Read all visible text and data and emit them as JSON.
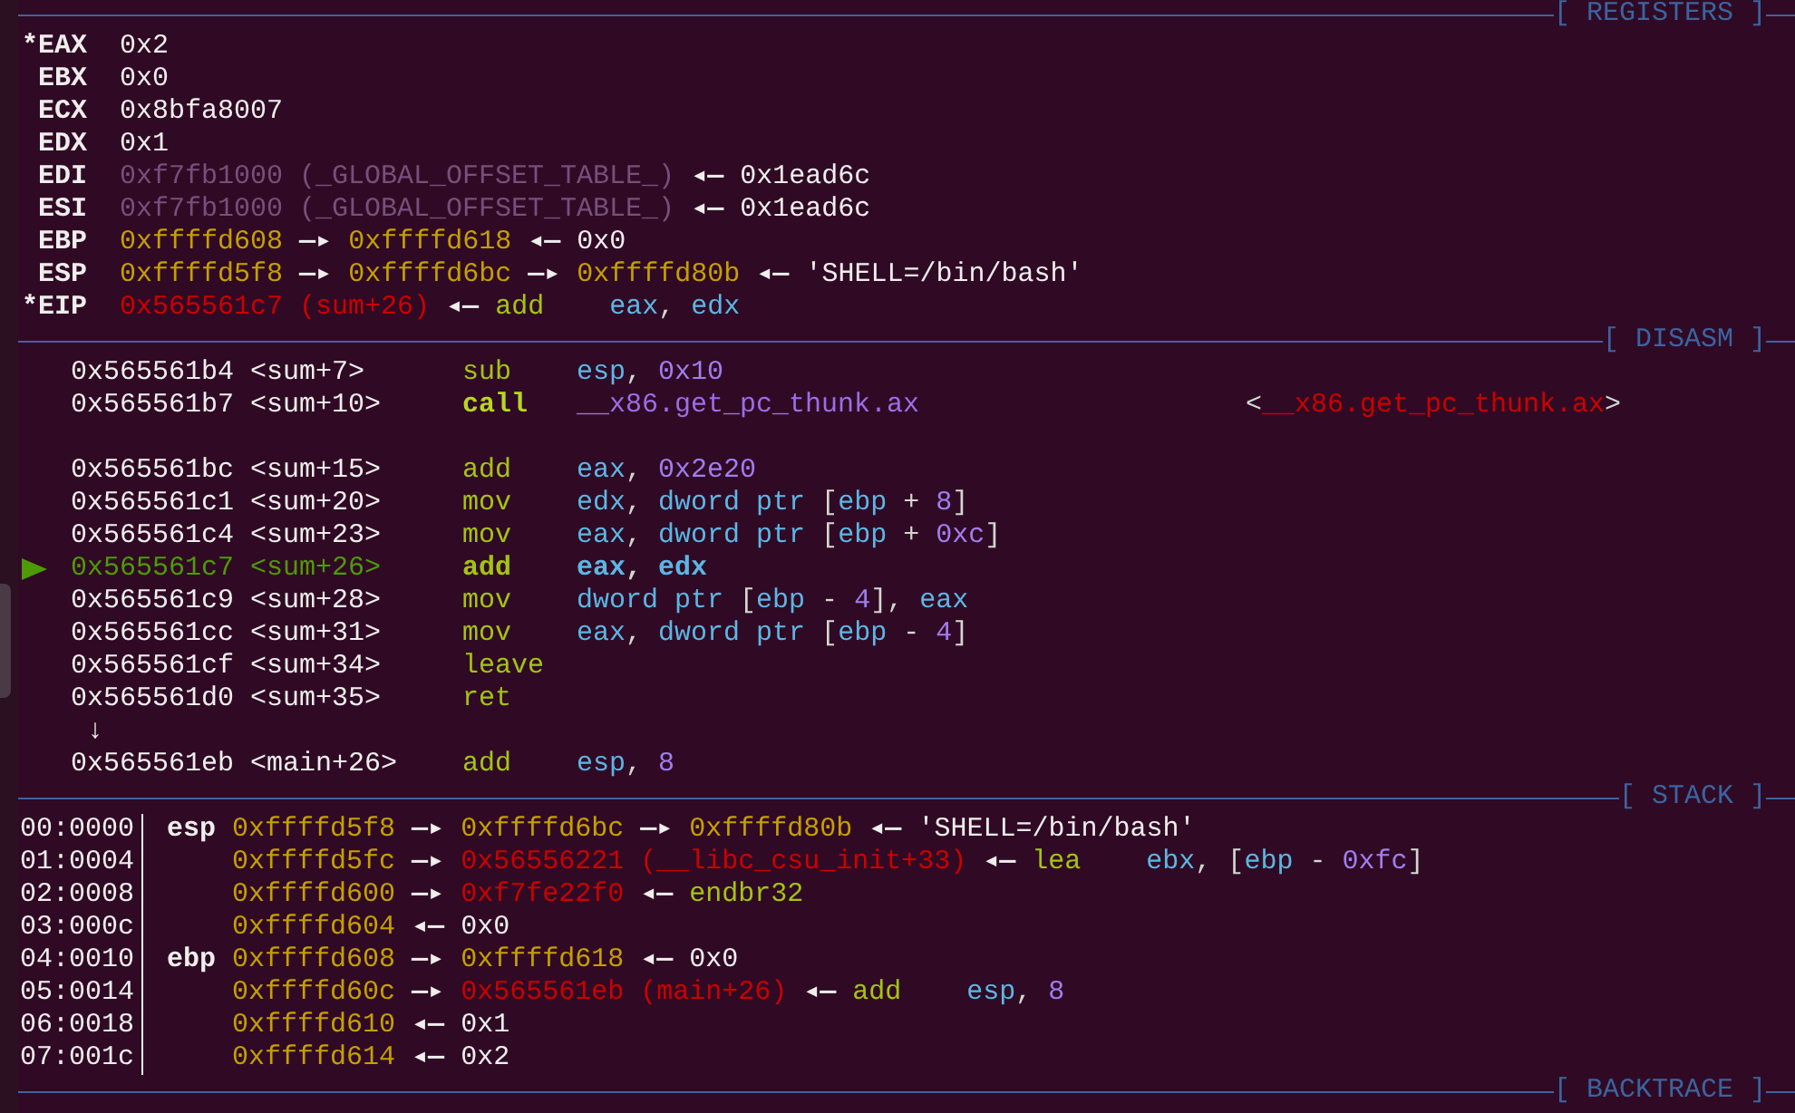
{
  "sections": [
    {
      "kind": "registers",
      "title": "[ REGISTERS ]",
      "rows": [
        {
          "flag": "*",
          "name": "EAX",
          "chain": [
            {
              "kind": "value",
              "text": "0x2"
            }
          ]
        },
        {
          "name": "EBX",
          "chain": [
            {
              "kind": "value",
              "text": "0x0"
            }
          ]
        },
        {
          "name": "ECX",
          "chain": [
            {
              "kind": "value",
              "text": "0x8bfa8007"
            }
          ]
        },
        {
          "name": "EDX",
          "chain": [
            {
              "kind": "value",
              "text": "0x1"
            }
          ]
        },
        {
          "name": "EDI",
          "chain": [
            {
              "kind": "dim",
              "text": "0xf7fb1000 (_GLOBAL_OFFSET_TABLE_)"
            },
            {
              "kind": "arrow",
              "text": "◂—"
            },
            {
              "kind": "value",
              "text": "0x1ead6c"
            }
          ]
        },
        {
          "name": "ESI",
          "chain": [
            {
              "kind": "dim",
              "text": "0xf7fb1000 (_GLOBAL_OFFSET_TABLE_)"
            },
            {
              "kind": "arrow",
              "text": "◂—"
            },
            {
              "kind": "value",
              "text": "0x1ead6c"
            }
          ]
        },
        {
          "name": "EBP",
          "chain": [
            {
              "kind": "stack",
              "text": "0xffffd608"
            },
            {
              "kind": "arrow",
              "text": "—▸"
            },
            {
              "kind": "stack",
              "text": "0xffffd618"
            },
            {
              "kind": "arrow",
              "text": "◂—"
            },
            {
              "kind": "value",
              "text": "0x0"
            }
          ]
        },
        {
          "name": "ESP",
          "chain": [
            {
              "kind": "stack",
              "text": "0xffffd5f8"
            },
            {
              "kind": "arrow",
              "text": "—▸"
            },
            {
              "kind": "stack",
              "text": "0xffffd6bc"
            },
            {
              "kind": "arrow",
              "text": "—▸"
            },
            {
              "kind": "stack",
              "text": "0xffffd80b"
            },
            {
              "kind": "arrow",
              "text": "◂—"
            },
            {
              "kind": "string",
              "text": "'SHELL=/bin/bash'"
            }
          ]
        },
        {
          "flag": "*",
          "name": "EIP",
          "chain": [
            {
              "kind": "code",
              "text": "0x565561c7 (sum+26)"
            },
            {
              "kind": "arrow",
              "text": "◂—"
            },
            {
              "kind": "insn",
              "mnemonic": "add",
              "operands": [
                {
                  "kind": "reg",
                  "text": "eax"
                },
                {
                  "kind": "punct",
                  "text": ", "
                },
                {
                  "kind": "reg",
                  "text": "edx"
                }
              ]
            }
          ]
        }
      ]
    },
    {
      "kind": "disasm",
      "title": "[ DISASM ]",
      "rows": [
        {
          "kind": "insn",
          "current": false,
          "branch": false,
          "address": "0x565561b4",
          "symbol": "<sum+7>",
          "mnemonic": "sub",
          "operands": [
            {
              "kind": "reg",
              "text": "esp"
            },
            {
              "kind": "punct",
              "text": ", "
            },
            {
              "kind": "num",
              "text": "0x10"
            }
          ]
        },
        {
          "kind": "insn",
          "current": false,
          "branch": true,
          "address": "0x565561b7",
          "symbol": "<sum+10>",
          "mnemonic": "call",
          "operands": [
            {
              "kind": "sym",
              "text": "__x86.get_pc_thunk.ax"
            }
          ],
          "target": [
            {
              "kind": "punct",
              "text": "<"
            },
            {
              "kind": "code",
              "text": "__x86.get_pc_thunk.ax"
            },
            {
              "kind": "punct",
              "text": ">"
            }
          ]
        },
        {
          "kind": "blank"
        },
        {
          "kind": "insn",
          "current": false,
          "branch": false,
          "address": "0x565561bc",
          "symbol": "<sum+15>",
          "mnemonic": "add",
          "operands": [
            {
              "kind": "reg",
              "text": "eax"
            },
            {
              "kind": "punct",
              "text": ", "
            },
            {
              "kind": "num",
              "text": "0x2e20"
            }
          ]
        },
        {
          "kind": "insn",
          "current": false,
          "branch": false,
          "address": "0x565561c1",
          "symbol": "<sum+20>",
          "mnemonic": "mov",
          "operands": [
            {
              "kind": "reg",
              "text": "edx"
            },
            {
              "kind": "punct",
              "text": ", "
            },
            {
              "kind": "reg",
              "text": "dword ptr"
            },
            {
              "kind": "punct",
              "text": " ["
            },
            {
              "kind": "reg",
              "text": "ebp"
            },
            {
              "kind": "punct",
              "text": " + "
            },
            {
              "kind": "num",
              "text": "8"
            },
            {
              "kind": "punct",
              "text": "]"
            }
          ]
        },
        {
          "kind": "insn",
          "current": false,
          "branch": false,
          "address": "0x565561c4",
          "symbol": "<sum+23>",
          "mnemonic": "mov",
          "operands": [
            {
              "kind": "reg",
              "text": "eax"
            },
            {
              "kind": "punct",
              "text": ", "
            },
            {
              "kind": "reg",
              "text": "dword ptr"
            },
            {
              "kind": "punct",
              "text": " ["
            },
            {
              "kind": "reg",
              "text": "ebp"
            },
            {
              "kind": "punct",
              "text": " + "
            },
            {
              "kind": "num",
              "text": "0xc"
            },
            {
              "kind": "punct",
              "text": "]"
            }
          ]
        },
        {
          "kind": "insn",
          "current": true,
          "branch": false,
          "address": "0x565561c7",
          "symbol": "<sum+26>",
          "mnemonic": "add",
          "operands": [
            {
              "kind": "reg",
              "text": "eax"
            },
            {
              "kind": "punct",
              "text": ", "
            },
            {
              "kind": "reg",
              "text": "edx"
            }
          ]
        },
        {
          "kind": "insn",
          "current": false,
          "branch": false,
          "address": "0x565561c9",
          "symbol": "<sum+28>",
          "mnemonic": "mov",
          "operands": [
            {
              "kind": "reg",
              "text": "dword ptr"
            },
            {
              "kind": "punct",
              "text": " ["
            },
            {
              "kind": "reg",
              "text": "ebp"
            },
            {
              "kind": "punct",
              "text": " - "
            },
            {
              "kind": "num",
              "text": "4"
            },
            {
              "kind": "punct",
              "text": "], "
            },
            {
              "kind": "reg",
              "text": "eax"
            }
          ]
        },
        {
          "kind": "insn",
          "current": false,
          "branch": false,
          "address": "0x565561cc",
          "symbol": "<sum+31>",
          "mnemonic": "mov",
          "operands": [
            {
              "kind": "reg",
              "text": "eax"
            },
            {
              "kind": "punct",
              "text": ", "
            },
            {
              "kind": "reg",
              "text": "dword ptr"
            },
            {
              "kind": "punct",
              "text": " ["
            },
            {
              "kind": "reg",
              "text": "ebp"
            },
            {
              "kind": "punct",
              "text": " - "
            },
            {
              "kind": "num",
              "text": "4"
            },
            {
              "kind": "punct",
              "text": "]"
            }
          ]
        },
        {
          "kind": "insn",
          "current": false,
          "branch": false,
          "address": "0x565561cf",
          "symbol": "<sum+34>",
          "mnemonic": "leave"
        },
        {
          "kind": "insn",
          "current": false,
          "branch": false,
          "address": "0x565561d0",
          "symbol": "<sum+35>",
          "mnemonic": "ret"
        },
        {
          "kind": "jump",
          "text": "↓"
        },
        {
          "kind": "insn",
          "current": false,
          "branch": false,
          "address": "0x565561eb",
          "symbol": "<main+26>",
          "mnemonic": "add",
          "operands": [
            {
              "kind": "reg",
              "text": "esp"
            },
            {
              "kind": "punct",
              "text": ", "
            },
            {
              "kind": "num",
              "text": "8"
            }
          ]
        }
      ]
    },
    {
      "kind": "stack",
      "title": "[ STACK ]",
      "rows": [
        {
          "offset": "00:0000",
          "label": "esp",
          "chain": [
            {
              "kind": "stack",
              "text": "0xffffd5f8"
            },
            {
              "kind": "arrow",
              "text": "—▸"
            },
            {
              "kind": "stack",
              "text": "0xffffd6bc"
            },
            {
              "kind": "arrow",
              "text": "—▸"
            },
            {
              "kind": "stack",
              "text": "0xffffd80b"
            },
            {
              "kind": "arrow",
              "text": "◂—"
            },
            {
              "kind": "string",
              "text": "'SHELL=/bin/bash'"
            }
          ]
        },
        {
          "offset": "01:0004",
          "chain": [
            {
              "kind": "stack",
              "text": "0xffffd5fc"
            },
            {
              "kind": "arrow",
              "text": "—▸"
            },
            {
              "kind": "code",
              "text": "0x56556221 (__libc_csu_init+33)"
            },
            {
              "kind": "arrow",
              "text": "◂—"
            },
            {
              "kind": "insn",
              "mnemonic": "lea",
              "operands": [
                {
                  "kind": "reg",
                  "text": "ebx"
                },
                {
                  "kind": "punct",
                  "text": ", ["
                },
                {
                  "kind": "reg",
                  "text": "ebp"
                },
                {
                  "kind": "punct",
                  "text": " - "
                },
                {
                  "kind": "num",
                  "text": "0xfc"
                },
                {
                  "kind": "punct",
                  "text": "]"
                }
              ]
            }
          ]
        },
        {
          "offset": "02:0008",
          "chain": [
            {
              "kind": "stack",
              "text": "0xffffd600"
            },
            {
              "kind": "arrow",
              "text": "—▸"
            },
            {
              "kind": "code",
              "text": "0xf7fe22f0"
            },
            {
              "kind": "arrow",
              "text": "◂—"
            },
            {
              "kind": "insn",
              "mnemonic": "endbr32"
            }
          ]
        },
        {
          "offset": "03:000c",
          "chain": [
            {
              "kind": "stack",
              "text": "0xffffd604"
            },
            {
              "kind": "arrow",
              "text": "◂—"
            },
            {
              "kind": "value",
              "text": "0x0"
            }
          ]
        },
        {
          "offset": "04:0010",
          "label": "ebp",
          "chain": [
            {
              "kind": "stack",
              "text": "0xffffd608"
            },
            {
              "kind": "arrow",
              "text": "—▸"
            },
            {
              "kind": "stack",
              "text": "0xffffd618"
            },
            {
              "kind": "arrow",
              "text": "◂—"
            },
            {
              "kind": "value",
              "text": "0x0"
            }
          ]
        },
        {
          "offset": "05:0014",
          "chain": [
            {
              "kind": "stack",
              "text": "0xffffd60c"
            },
            {
              "kind": "arrow",
              "text": "—▸"
            },
            {
              "kind": "code",
              "text": "0x565561eb (main+26)"
            },
            {
              "kind": "arrow",
              "text": "◂—"
            },
            {
              "kind": "insn",
              "mnemonic": "add",
              "operands": [
                {
                  "kind": "reg",
                  "text": "esp"
                },
                {
                  "kind": "punct",
                  "text": ", "
                },
                {
                  "kind": "num",
                  "text": "8"
                }
              ]
            }
          ]
        },
        {
          "offset": "06:0018",
          "chain": [
            {
              "kind": "stack",
              "text": "0xffffd610"
            },
            {
              "kind": "arrow",
              "text": "◂—"
            },
            {
              "kind": "value",
              "text": "0x1"
            }
          ]
        },
        {
          "offset": "07:001c",
          "chain": [
            {
              "kind": "stack",
              "text": "0xffffd614"
            },
            {
              "kind": "arrow",
              "text": "◂—"
            },
            {
              "kind": "value",
              "text": "0x2"
            }
          ]
        }
      ]
    },
    {
      "kind": "backtrace",
      "title": "[ BACKTRACE ]"
    }
  ]
}
